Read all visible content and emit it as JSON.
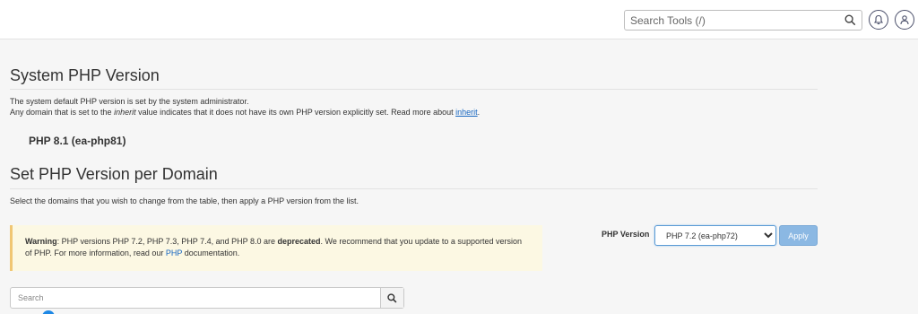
{
  "header": {
    "search_placeholder": "Search Tools (/)",
    "icons": [
      "search-icon",
      "bell-icon",
      "user-icon"
    ]
  },
  "system_php": {
    "title": "System PHP Version",
    "line1": "The system default PHP version is set by the system administrator.",
    "line2_pre": "Any domain that is set to the ",
    "line2_em": "inherit",
    "line2_mid": " value indicates that it does not have its own PHP version explicitly set. Read more about ",
    "line2_link": "inherit",
    "line2_post": ".",
    "current_version": "PHP 8.1 (ea-php81)"
  },
  "per_domain": {
    "title": "Set PHP Version per Domain",
    "description": "Select the domains that you wish to change from the table, then apply a PHP version from the list."
  },
  "warning": {
    "label": "Warning",
    "text1": ": PHP versions PHP 7.2, PHP 7.3, PHP 7.4, and PHP 8.0 are ",
    "bold": "deprecated",
    "text2": ". We recommend that you update to a supported version of PHP. For more information, read our ",
    "link": "PHP",
    "text3": " documentation."
  },
  "php_version": {
    "label": "PHP Version",
    "selected": "PHP 7.2 (ea-php72)",
    "apply_label": "Apply"
  },
  "table_search": {
    "placeholder": "Search"
  },
  "colors": {
    "link": "#1565c0",
    "warning_bg": "#fcf8e3",
    "warning_border": "#f0c674",
    "apply_bg": "#8bb8e3"
  }
}
